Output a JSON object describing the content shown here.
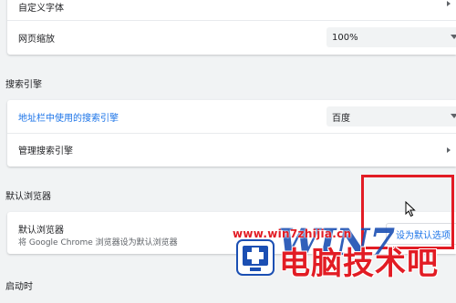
{
  "appearance": {
    "custom_fonts_label": "自定义字体",
    "page_zoom_label": "网页缩放",
    "page_zoom_value": "100%"
  },
  "search_engine": {
    "section_title": "搜索引擎",
    "address_bar_label": "地址栏中使用的搜索引擎",
    "address_bar_value": "百度",
    "manage_label": "管理搜索引擎"
  },
  "default_browser": {
    "section_title": "默认浏览器",
    "row_title": "默认浏览器",
    "row_subtitle": "将 Google Chrome 浏览器设为默认浏览器",
    "button_label": "设为默认选项"
  },
  "startup": {
    "section_title": "启动时"
  },
  "watermark": {
    "url": "www.win7zhijia.cn",
    "brand": "电脑技术吧",
    "logo_text": "WIN7"
  },
  "colors": {
    "highlight": "#e21c24",
    "link": "#1a73e8",
    "background": "#f1f3f4"
  }
}
